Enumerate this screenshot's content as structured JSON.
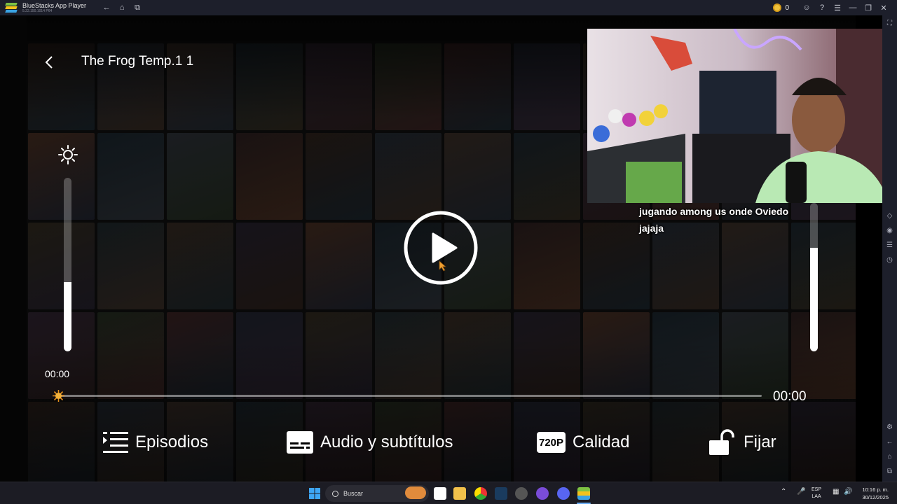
{
  "window": {
    "app_title": "BlueStacks App Player",
    "app_version": "5.22.150.1014 P64",
    "coin_count": "0"
  },
  "player": {
    "title": "The Frog Temp.1 1",
    "time_elapsed": "00:00",
    "time_total": "00:00",
    "progress_fraction": 0.0,
    "brightness_level": 0.4,
    "volume_level": 0.7
  },
  "controls": {
    "episodes_label": "Episodios",
    "audio_label": "Audio y subtítulos",
    "quality_badge": "720P",
    "quality_label": "Calidad",
    "lock_label": "Fijar"
  },
  "overlay": {
    "chat_message": "jugando among us onde Oviedo jajaja"
  },
  "taskbar": {
    "search_placeholder": "Buscar",
    "lang_top": "ESP",
    "lang_bottom": "LAA",
    "time": "10:16 p. m.",
    "date": "30/12/2025"
  },
  "icons": {
    "back": "chevron-left-icon",
    "brightness": "sun-icon",
    "play": "play-circle-icon",
    "episodes": "list-icon",
    "audio": "subtitles-icon",
    "lock": "unlock-icon"
  },
  "colors": {
    "accent": "#ffffff",
    "seek_thumb": "#f0a030",
    "titlebar_bg": "#1d1f2b"
  }
}
